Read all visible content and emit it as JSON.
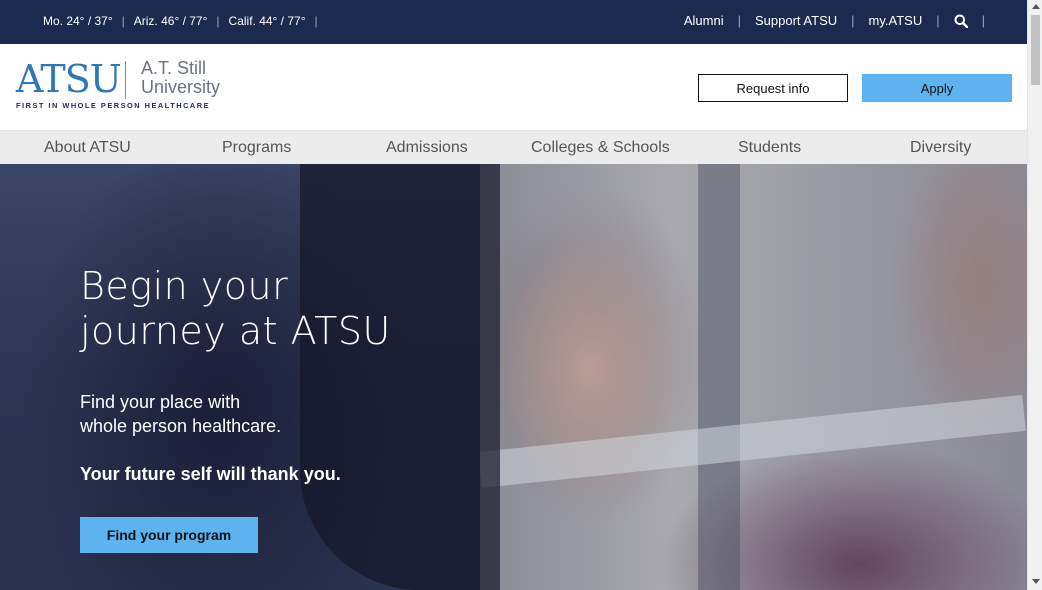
{
  "utility_bar": {
    "weather": [
      {
        "text": "Mo. 24° / 37°"
      },
      {
        "text": "Ariz. 46° / 77°"
      },
      {
        "text": "Calif. 44° / 77°"
      }
    ],
    "links": [
      {
        "label": "Alumni"
      },
      {
        "label": "Support ATSU"
      },
      {
        "label": "my.ATSU"
      }
    ],
    "search_icon": "search-icon",
    "separator": "|"
  },
  "header": {
    "logo": {
      "mark": "ATSU",
      "name_line1": "A.T. Still",
      "name_line2": "University",
      "tagline": "FIRST IN WHOLE PERSON HEALTHCARE"
    },
    "request_info_label": "Request info",
    "apply_label": "Apply"
  },
  "main_nav": [
    {
      "label": "About ATSU"
    },
    {
      "label": "Programs"
    },
    {
      "label": "Admissions"
    },
    {
      "label": "Colleges & Schools"
    },
    {
      "label": "Students"
    },
    {
      "label": "Diversity"
    }
  ],
  "hero": {
    "title_line1": "Begin your",
    "title_line2": "journey at ATSU",
    "subtitle_line1": "Find your place with",
    "subtitle_line2": "whole person healthcare.",
    "tagline": "Your future self will thank you.",
    "cta_label": "Find your program"
  },
  "colors": {
    "utility_bg": "#1b2a4e",
    "accent_blue": "#5cb3f0",
    "logo_blue": "#2f78b7",
    "nav_bg": "#ececec"
  }
}
